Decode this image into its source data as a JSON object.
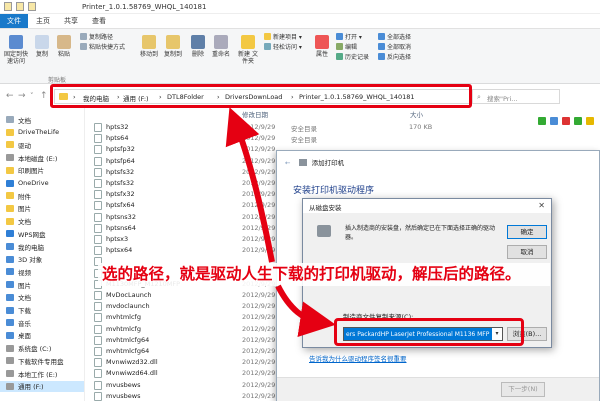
{
  "window": {
    "title": "Printer_1.0.1.58769_WHQL_140181"
  },
  "ribbon_tabs": [
    "文件",
    "主页",
    "共享",
    "查看"
  ],
  "ribbon": {
    "pin": "固定到快速访问",
    "copy": "复制",
    "paste": "粘贴",
    "copy_path": "复制路径",
    "paste_shortcut": "粘贴快捷方式",
    "move_to": "移动到",
    "copy_to": "复制到",
    "delete": "删除",
    "rename": "重命名",
    "new_folder": "新建\n文件夹",
    "new_item": "新建项目 ▾",
    "easy_access": "轻松访问 ▾",
    "properties": "属性",
    "open": "打开 ▾",
    "edit": "编辑",
    "history": "历史记录",
    "select_all": "全部选择",
    "select_none": "全部取消",
    "invert": "反向选择",
    "group_clipboard": "剪贴板"
  },
  "address": {
    "crumbs": [
      "›",
      "我的电脑",
      "›",
      "通用 (F:)",
      "›",
      "DTL8Folder",
      "›",
      "DriversDownLoad",
      "›",
      "Printer_1.0.1.58769_WHQL_140181"
    ],
    "search_placeholder": "搜索\"Pri..."
  },
  "columns": {
    "date": "修改日期",
    "size": "大小"
  },
  "sidebar": [
    {
      "label": "文档",
      "color": "#9ab"
    },
    {
      "label": "DriveTheLife",
      "color": "#f3c843"
    },
    {
      "label": "驱动",
      "color": "#f3c843"
    },
    {
      "label": "本地磁盘 (E:)",
      "color": "#999"
    },
    {
      "label": "印刷图片",
      "color": "#f3c843"
    },
    {
      "label": "OneDrive",
      "color": "#2f7fd6"
    },
    {
      "label": "附件",
      "color": "#f3c843"
    },
    {
      "label": "图片",
      "color": "#f3c843"
    },
    {
      "label": "文档",
      "color": "#f3c843"
    },
    {
      "label": "WPS网盘",
      "color": "#2f7fd6"
    },
    {
      "label": "我的电脑",
      "color": "#4a8cd6"
    },
    {
      "label": "3D 对象",
      "color": "#4a8cd6"
    },
    {
      "label": "视频",
      "color": "#4a8cd6"
    },
    {
      "label": "图片",
      "color": "#4a8cd6"
    },
    {
      "label": "文档",
      "color": "#4a8cd6"
    },
    {
      "label": "下载",
      "color": "#4a8cd6"
    },
    {
      "label": "音乐",
      "color": "#4a8cd6"
    },
    {
      "label": "桌面",
      "color": "#4a8cd6"
    },
    {
      "label": "系统盘 (C:)",
      "color": "#999"
    },
    {
      "label": "下载软件专用盘",
      "color": "#999"
    },
    {
      "label": "本地工作 (E:)",
      "color": "#999"
    },
    {
      "label": "通用 (F:)",
      "color": "#999",
      "selected": true
    }
  ],
  "files": [
    {
      "name": "hpts32",
      "date": "2012/9/29",
      "type": "安全目录",
      "size": "170 KB"
    },
    {
      "name": "hpts64",
      "date": "2012/9/29",
      "type": "安全目录",
      "size": ""
    },
    {
      "name": "hptsfp32",
      "date": "2012/9/29",
      "type": "",
      "size": ""
    },
    {
      "name": "hptsfp64",
      "date": "2012/9/29",
      "type": "",
      "size": ""
    },
    {
      "name": "hptsfs32",
      "date": "2012/9/29",
      "type": "",
      "size": ""
    },
    {
      "name": "hptsfs32",
      "date": "2012/9/29",
      "type": "",
      "size": ""
    },
    {
      "name": "hptsfx32",
      "date": "2012/9/29",
      "type": "",
      "size": ""
    },
    {
      "name": "hptsfx64",
      "date": "2012/9/29",
      "type": "",
      "size": ""
    },
    {
      "name": "hptsns32",
      "date": "2012/9/29",
      "type": "",
      "size": ""
    },
    {
      "name": "hptsns64",
      "date": "2012/9/29",
      "type": "",
      "size": ""
    },
    {
      "name": "hptsx3",
      "date": "2012/9/29",
      "type": "",
      "size": ""
    },
    {
      "name": "hptsx64",
      "date": "2012/9/29",
      "type": "",
      "size": ""
    },
    {
      "name": "",
      "date": "",
      "type": "",
      "size": ""
    },
    {
      "name": "",
      "date": "",
      "type": "",
      "size": ""
    },
    {
      "name": "M1130MFP_M1210MFP",
      "date": "2012/9/29",
      "type": "",
      "size": ""
    },
    {
      "name": "MvDocLaunch",
      "date": "2012/9/29",
      "type": "",
      "size": ""
    },
    {
      "name": "mvdoclaunch",
      "date": "2012/9/29",
      "type": "",
      "size": ""
    },
    {
      "name": "mvhtmlcfg",
      "date": "2012/9/29",
      "type": "",
      "size": ""
    },
    {
      "name": "mvhtmlcfg",
      "date": "2012/9/29",
      "type": "",
      "size": ""
    },
    {
      "name": "mvhtmlcfg64",
      "date": "2012/9/29",
      "type": "",
      "size": ""
    },
    {
      "name": "mvhtmlcfg64",
      "date": "2012/9/29",
      "type": "",
      "size": ""
    },
    {
      "name": "Mvnwiwzd32.dll",
      "date": "2012/9/29",
      "type": "",
      "size": ""
    },
    {
      "name": "Mvnwiwzd64.dll",
      "date": "2012/9/29",
      "type": "",
      "size": ""
    },
    {
      "name": "mvusbews",
      "date": "2012/9/29",
      "type": "",
      "size": ""
    },
    {
      "name": "mvusbews",
      "date": "2012/9/29",
      "type": "",
      "size": ""
    }
  ],
  "wizard": {
    "title": "添加打印机",
    "heading": "安装打印机驱动程序",
    "link": "告诉我为什么驱动程序签名很重要",
    "next": "下一步(N)"
  },
  "disk_dialog": {
    "title": "从磁盘安装",
    "message": "插入制造商的安装盘，然后确定已在下面选择正确的驱动器。",
    "ok": "确定",
    "cancel": "取消",
    "path_label": "制造商文件复制来源(C):",
    "path_value": "ers PackardHP LaserJet Professional M1136 MFP",
    "browse": "浏览(B)..."
  },
  "annotation": "选的路径，就是驱动人生下载的打印机驱动，解压后的路径。",
  "colors": {
    "highlight": "#e50012",
    "accent": "#1979ca",
    "select": "#0078d7"
  }
}
